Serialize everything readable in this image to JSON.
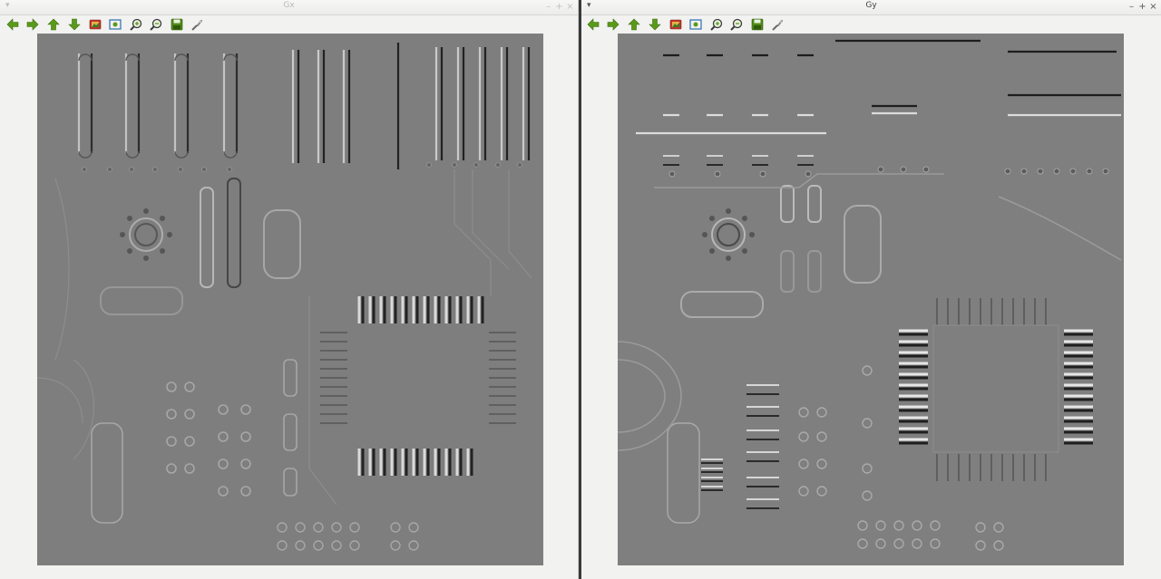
{
  "windows": [
    {
      "id": "gx",
      "title": "Gx",
      "toolbar": [
        "arrow-left-icon",
        "arrow-right-icon",
        "arrow-up-icon",
        "arrow-down-icon",
        "image-icon",
        "zoom-fit-icon",
        "zoom-in-icon",
        "zoom-out-icon",
        "save-icon",
        "properties-icon"
      ],
      "image": "Horizontal gradient (Sobel Gx) of circuit board"
    },
    {
      "id": "gy",
      "title": "Gy",
      "toolbar": [
        "arrow-left-icon",
        "arrow-right-icon",
        "arrow-up-icon",
        "arrow-down-icon",
        "image-icon",
        "zoom-fit-icon",
        "zoom-in-icon",
        "zoom-out-icon",
        "save-icon",
        "properties-icon"
      ],
      "image": "Vertical gradient (Sobel Gy) of circuit board"
    }
  ],
  "window_controls": {
    "minimize": "–",
    "maximize": "+",
    "close": "×",
    "menu": "▾"
  },
  "colors": {
    "canvas_gray": "#7f7f7f",
    "icon_green": "#5a9a1a",
    "icon_red": "#c0392b"
  }
}
